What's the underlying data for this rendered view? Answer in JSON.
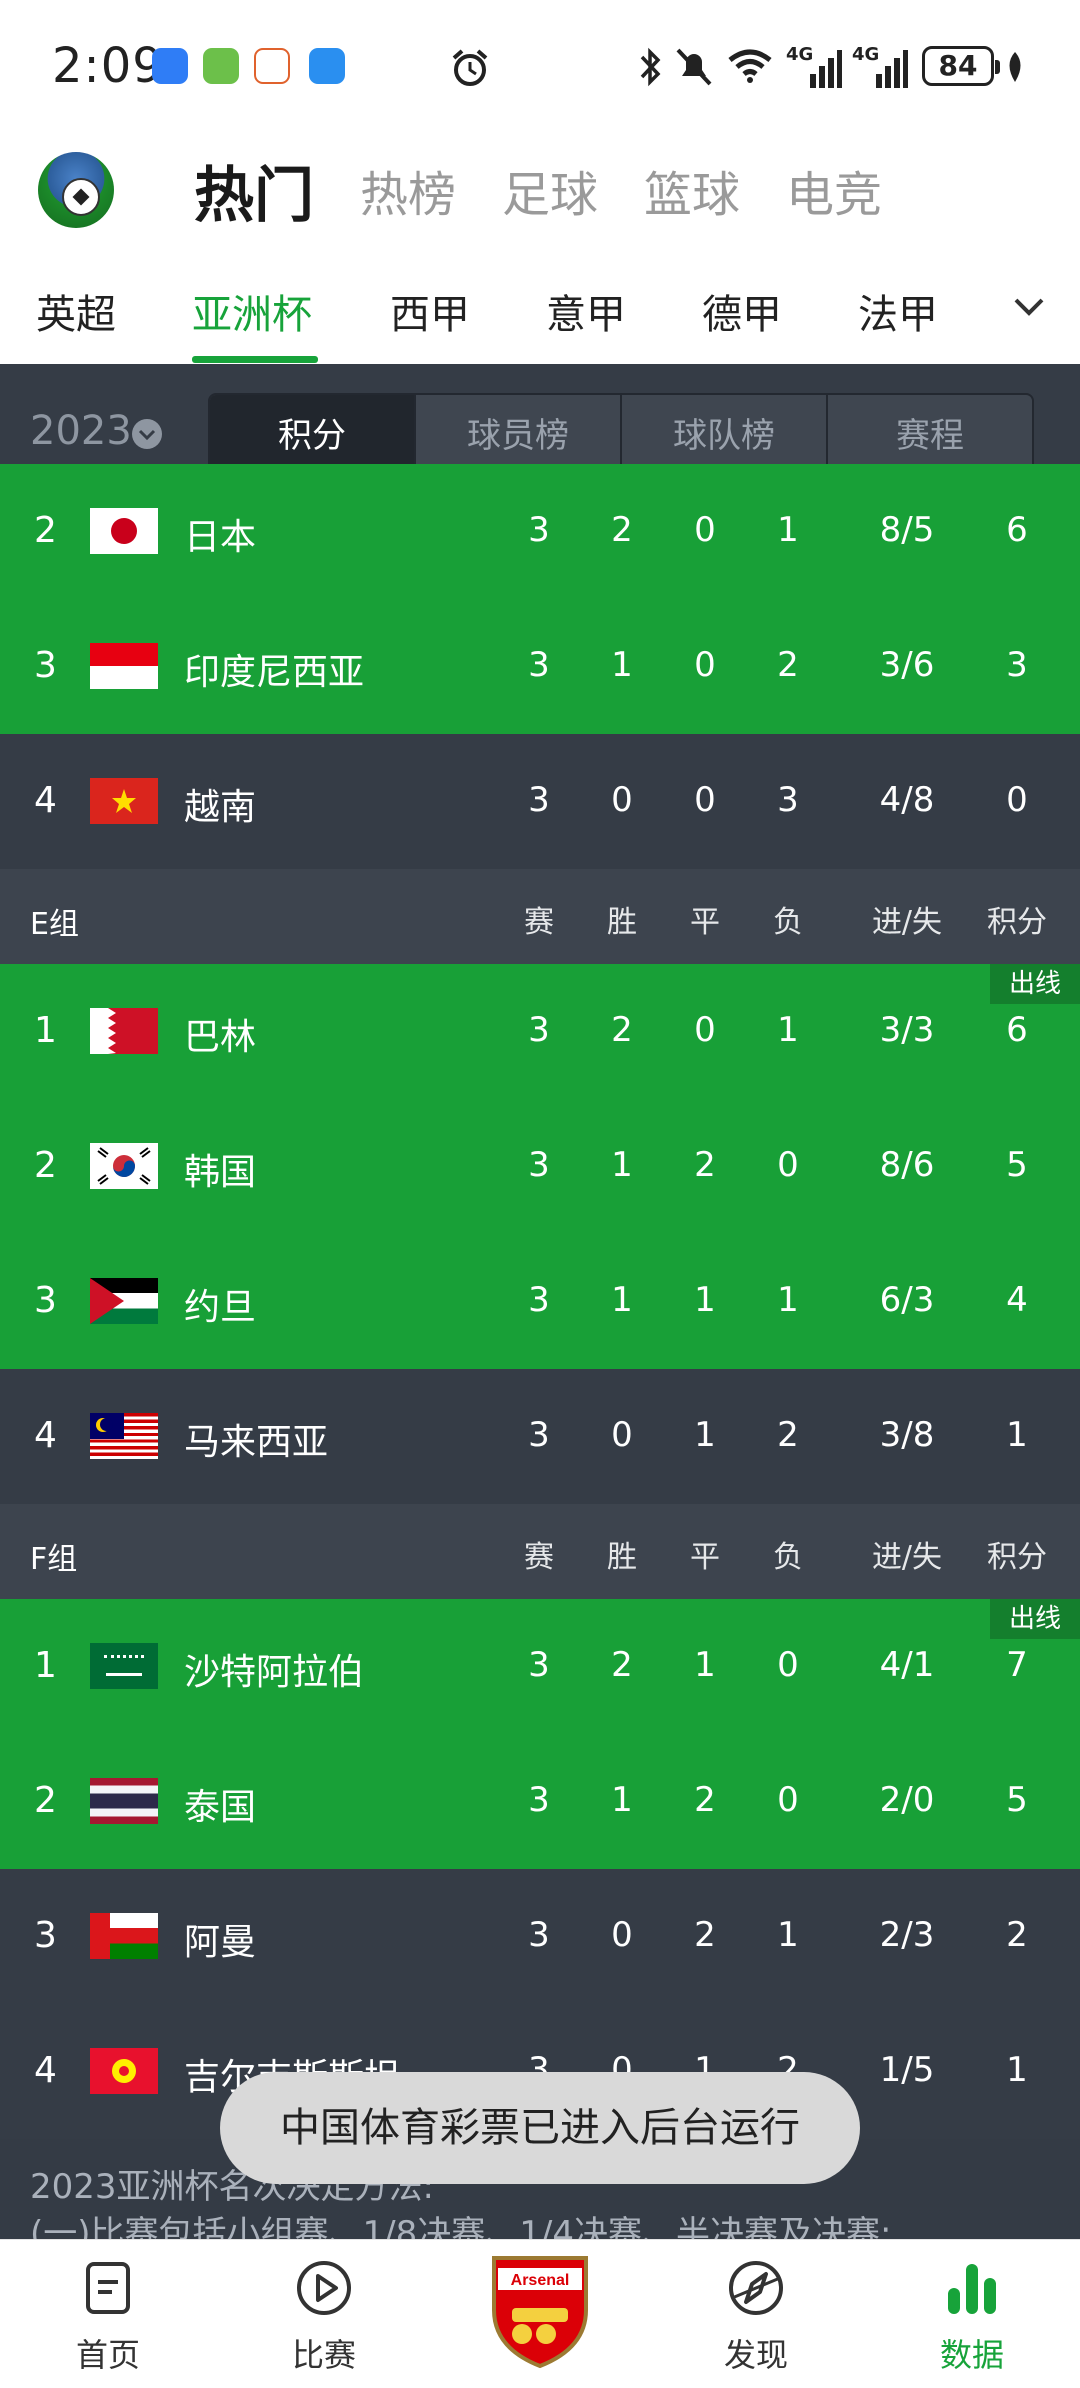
{
  "status_bar": {
    "time": "2:09",
    "battery": "84",
    "network": "4G"
  },
  "top_tabs": [
    {
      "label": "热门",
      "active": true
    },
    {
      "label": "热榜",
      "active": false
    },
    {
      "label": "足球",
      "active": false
    },
    {
      "label": "篮球",
      "active": false
    },
    {
      "label": "电竞",
      "active": false
    }
  ],
  "league_tabs": [
    {
      "label": "英超",
      "active": false
    },
    {
      "label": "亚洲杯",
      "active": true
    },
    {
      "label": "西甲",
      "active": false
    },
    {
      "label": "意甲",
      "active": false
    },
    {
      "label": "德甲",
      "active": false
    },
    {
      "label": "法甲",
      "active": false
    }
  ],
  "filter": {
    "season": "2023",
    "segments": [
      {
        "label": "积分",
        "active": true
      },
      {
        "label": "球员榜",
        "active": false
      },
      {
        "label": "球队榜",
        "active": false
      },
      {
        "label": "赛程",
        "active": false
      }
    ]
  },
  "columns": [
    "赛",
    "胜",
    "平",
    "负",
    "进/失",
    "积分"
  ],
  "groups": [
    {
      "name": "",
      "rows": [
        {
          "rank": "2",
          "team": "日本",
          "flag": "japan",
          "p": "3",
          "w": "2",
          "d": "0",
          "l": "1",
          "gf_ga": "8/5",
          "pts": "6",
          "status": "green"
        },
        {
          "rank": "3",
          "team": "印度尼西亚",
          "flag": "indonesia",
          "p": "3",
          "w": "1",
          "d": "0",
          "l": "2",
          "gf_ga": "3/6",
          "pts": "3",
          "status": "green"
        },
        {
          "rank": "4",
          "team": "越南",
          "flag": "vietnam",
          "p": "3",
          "w": "0",
          "d": "0",
          "l": "3",
          "gf_ga": "4/8",
          "pts": "0",
          "status": "dark"
        }
      ]
    },
    {
      "name": "E组",
      "qualify_label": "出线",
      "rows": [
        {
          "rank": "1",
          "team": "巴林",
          "flag": "bahrain",
          "p": "3",
          "w": "2",
          "d": "0",
          "l": "1",
          "gf_ga": "3/3",
          "pts": "6",
          "status": "green"
        },
        {
          "rank": "2",
          "team": "韩国",
          "flag": "korea",
          "p": "3",
          "w": "1",
          "d": "2",
          "l": "0",
          "gf_ga": "8/6",
          "pts": "5",
          "status": "green"
        },
        {
          "rank": "3",
          "team": "约旦",
          "flag": "jordan",
          "p": "3",
          "w": "1",
          "d": "1",
          "l": "1",
          "gf_ga": "6/3",
          "pts": "4",
          "status": "green"
        },
        {
          "rank": "4",
          "team": "马来西亚",
          "flag": "malaysia",
          "p": "3",
          "w": "0",
          "d": "1",
          "l": "2",
          "gf_ga": "3/8",
          "pts": "1",
          "status": "dark"
        }
      ]
    },
    {
      "name": "F组",
      "qualify_label": "出线",
      "rows": [
        {
          "rank": "1",
          "team": "沙特阿拉伯",
          "flag": "saudi",
          "p": "3",
          "w": "2",
          "d": "1",
          "l": "0",
          "gf_ga": "4/1",
          "pts": "7",
          "status": "green"
        },
        {
          "rank": "2",
          "team": "泰国",
          "flag": "thailand",
          "p": "3",
          "w": "1",
          "d": "2",
          "l": "0",
          "gf_ga": "2/0",
          "pts": "5",
          "status": "green"
        },
        {
          "rank": "3",
          "team": "阿曼",
          "flag": "oman",
          "p": "3",
          "w": "0",
          "d": "2",
          "l": "1",
          "gf_ga": "2/3",
          "pts": "2",
          "status": "dark"
        },
        {
          "rank": "4",
          "team": "吉尔吉斯斯坦",
          "flag": "kyrgyzstan",
          "p": "3",
          "w": "0",
          "d": "1",
          "l": "2",
          "gf_ga": "1/5",
          "pts": "1",
          "status": "dark"
        }
      ]
    }
  ],
  "notes": {
    "line1": "2023亚洲杯名次决定方法:",
    "line2": "(一)比赛包括小组赛、1/8决赛、1/4决赛、半决赛及决赛;"
  },
  "toast": "中国体育彩票已进入后台运行",
  "bottom_nav": [
    {
      "label": "首页",
      "icon": "document-icon",
      "active": false
    },
    {
      "label": "比赛",
      "icon": "play-icon",
      "active": false
    },
    {
      "label": "Arsenal",
      "icon": "arsenal-crest-icon",
      "active": false
    },
    {
      "label": "发现",
      "icon": "compass-icon",
      "active": false
    },
    {
      "label": "数据",
      "icon": "bar-chart-icon",
      "active": true
    }
  ],
  "colors": {
    "accent": "#17a33a",
    "qualified_row": "#18a037",
    "dark_row": "#353c46"
  }
}
